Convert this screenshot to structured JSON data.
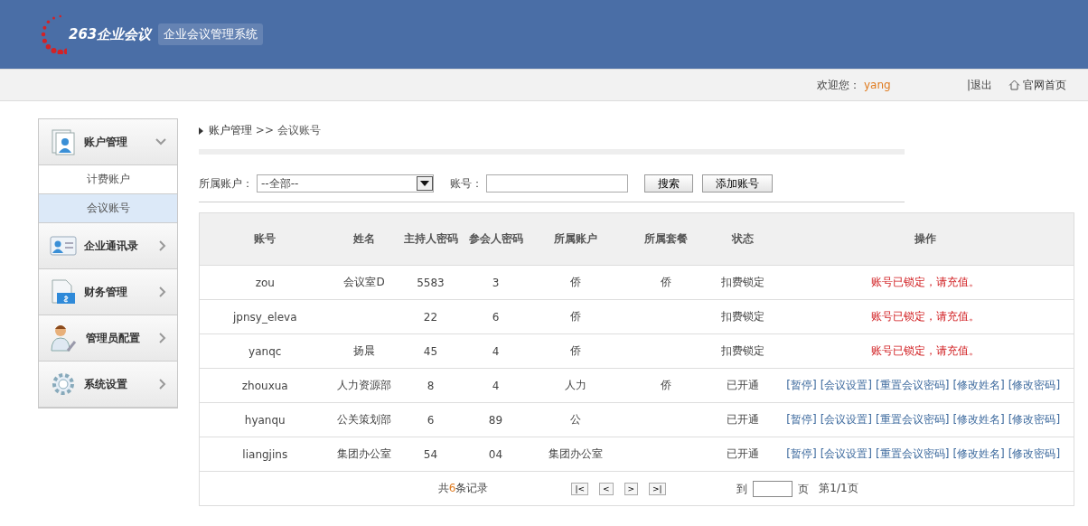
{
  "header": {
    "logo_text": "263企业会议",
    "system_title": "企业会议管理系统"
  },
  "user_bar": {
    "welcome_label": "欢迎您：",
    "username": "yang",
    "logout": "|退出",
    "home_link": "官网首页"
  },
  "sidebar": {
    "items": [
      {
        "label": "账户管理",
        "kind": "account",
        "expanded": true,
        "children": [
          {
            "label": "计费账户",
            "selected": false
          },
          {
            "label": "会议账号",
            "selected": true
          }
        ]
      },
      {
        "label": "企业通讯录",
        "kind": "contacts",
        "expanded": false
      },
      {
        "label": "财务管理",
        "kind": "finance",
        "expanded": false
      },
      {
        "label": "管理员配置",
        "kind": "admin",
        "expanded": false
      },
      {
        "label": "系统设置",
        "kind": "settings",
        "expanded": false
      }
    ]
  },
  "breadcrumb": {
    "parent": "账户管理",
    "separator": ">>",
    "current": "会议账号"
  },
  "filters": {
    "owner_label": "所属账户：",
    "owner_value": "--全部--",
    "account_label": "账号：",
    "search_button": "搜索",
    "add_button": "添加账号"
  },
  "table": {
    "columns": [
      "账号",
      "姓名",
      "主持人密码",
      "参会人密码",
      "所属账户",
      "所属套餐",
      "状态",
      "操作"
    ],
    "rows": [
      {
        "cells": [
          "zou",
          "会议室D",
          "5583",
          "3",
          "侨",
          "侨"
        ],
        "status": "扣费锁定",
        "kind": "locked",
        "message": "账号已锁定，请充值。"
      },
      {
        "cells": [
          "jpnsy_eleva",
          "",
          "22",
          "6",
          "侨",
          ""
        ],
        "status": "扣费锁定",
        "kind": "locked",
        "message": "账号已锁定，请充值。"
      },
      {
        "cells": [
          "yanqc",
          "扬晨",
          "45",
          "4",
          "侨",
          ""
        ],
        "status": "扣费锁定",
        "kind": "locked",
        "message": "账号已锁定，请充值。"
      },
      {
        "cells": [
          "zhouxua",
          "人力资源部",
          "8",
          "4",
          "人力",
          "侨"
        ],
        "status": "已开通",
        "kind": "active",
        "actions": [
          "[暂停]",
          "[会议设置]",
          "[重置会议密码]",
          "[修改姓名]",
          "[修改密码]"
        ]
      },
      {
        "cells": [
          "hyanqu",
          "公关策划部",
          "6",
          "89",
          "公",
          ""
        ],
        "status": "已开通",
        "kind": "active",
        "actions": [
          "[暂停]",
          "[会议设置]",
          "[重置会议密码]",
          "[修改姓名]",
          "[修改密码]"
        ]
      },
      {
        "cells": [
          "liangjins",
          "集团办公室",
          "54",
          "04",
          "集团办公室",
          ""
        ],
        "status": "已开通",
        "kind": "active",
        "actions": [
          "[暂停]",
          "[会议设置]",
          "[重置会议密码]",
          "[修改姓名]",
          "[修改密码]"
        ]
      }
    ]
  },
  "pagination": {
    "total_prefix": "共",
    "total_count": "6",
    "total_suffix": "条记录",
    "first": "|<",
    "prev": "<",
    "next": ">",
    "last": ">|",
    "goto_label": "到",
    "page_label": "页",
    "page_info": "第1/1页"
  }
}
